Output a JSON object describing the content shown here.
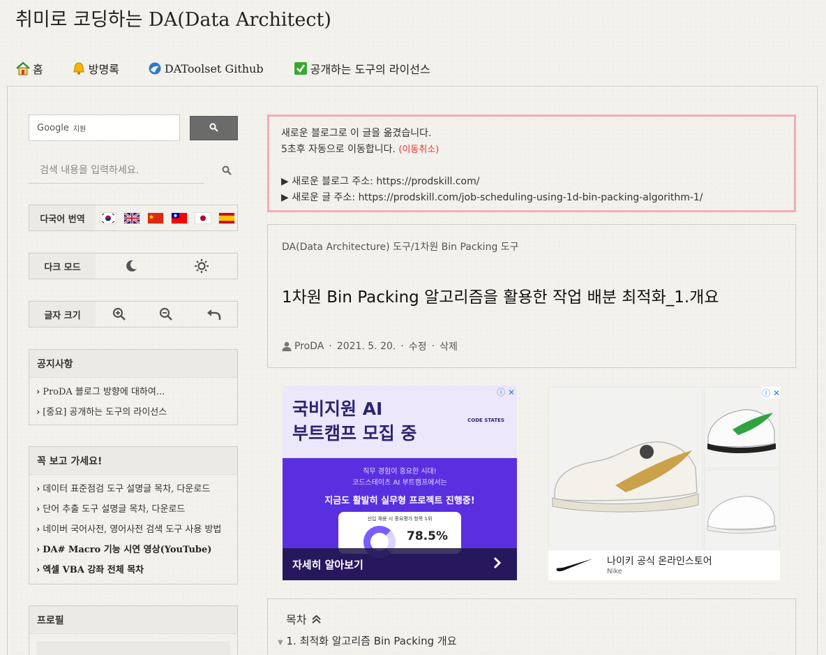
{
  "site": {
    "title": "취미로 코딩하는 DA(Data Architect)"
  },
  "nav": {
    "items": [
      {
        "label": "홈",
        "icon": "home-icon"
      },
      {
        "label": "방명록",
        "icon": "bell-icon"
      },
      {
        "label": "DAToolset Github",
        "icon": "github-icon"
      },
      {
        "label": "공개하는 도구의 라이선스",
        "icon": "checkbox-icon"
      }
    ]
  },
  "sidebar": {
    "google_search": {
      "brand": "Google",
      "sub": "지원",
      "button_icon": "search-icon"
    },
    "blog_search": {
      "placeholder": "검색 내용을 입력하세요."
    },
    "translate": {
      "label": "다국어 번역",
      "flags": [
        "korea",
        "uk",
        "china",
        "taiwan",
        "japan",
        "spain"
      ]
    },
    "dark_mode": {
      "label": "다크 모드",
      "icons": [
        "moon-icon",
        "sun-icon"
      ]
    },
    "font_size": {
      "label": "글자 크기",
      "icons": [
        "zoom-in-icon",
        "zoom-out-icon",
        "reset-icon"
      ]
    },
    "notices": {
      "title": "공지사항",
      "items": [
        "ProDA 블로그 방향에 대하여...",
        "[중요] 공개하는 도구의 라이선스"
      ]
    },
    "must_read": {
      "title": "꼭 보고 가세요!",
      "items": [
        "데이터 표준점검 도구 설명글 목차, 다운로드",
        "단어 추출 도구 설명글 목차, 다운로드",
        "네이버 국어사전, 영어사전 검색 도구 사용 방법",
        "DA# Macro 기능 시연 영상(YouTube)",
        "엑셀 VBA 강좌 전체 목차"
      ]
    },
    "profile": {
      "title": "프로필"
    }
  },
  "notice": {
    "line1": "새로운 블로그로 이 글을 옮겼습니다.",
    "line2": "5초후 자동으로 이동합니다.",
    "cancel": "(이동취소)",
    "line3": "▶ 새로운 블로그 주소: https://prodskill.com/",
    "line4": "▶ 새로운 글 주소: https://prodskill.com/job-scheduling-using-1d-bin-packing-algorithm-1/"
  },
  "post": {
    "category": "DA(Data Architecture) 도구/1차원 Bin Packing 도구",
    "title": "1차원 Bin Packing 알고리즘을 활용한 작업 배분 최적화_1.개요",
    "author": "ProDA",
    "date": "2021. 5. 20.",
    "edit": "수정",
    "delete": "삭제"
  },
  "ad1": {
    "headline1": "국비지원 AI",
    "headline2": "부트캠프 모집 중",
    "brand": "CODE STATES",
    "sub1": "직무 경험이 중요한 시대!",
    "sub2": "코드스테이츠 AI 부트캠프에서는",
    "highlight": "지금도 활발히 실무형 프로젝트 진행중!",
    "stat_title": "신입 채용 시 중요평가 항목 1위",
    "stat_value": "78.5%",
    "cta": "자세히 알아보기"
  },
  "ad2": {
    "name": "나이키 공식 온라인스토어",
    "sub": "Nike"
  },
  "toc": {
    "title": "목차",
    "first_item": "1. 최적화 알고리즘 Bin Packing 개요"
  },
  "colors": {
    "notice_border": "#f0aeb0",
    "accent_red": "#e33333",
    "ad_purple": "#5a2fe0"
  }
}
